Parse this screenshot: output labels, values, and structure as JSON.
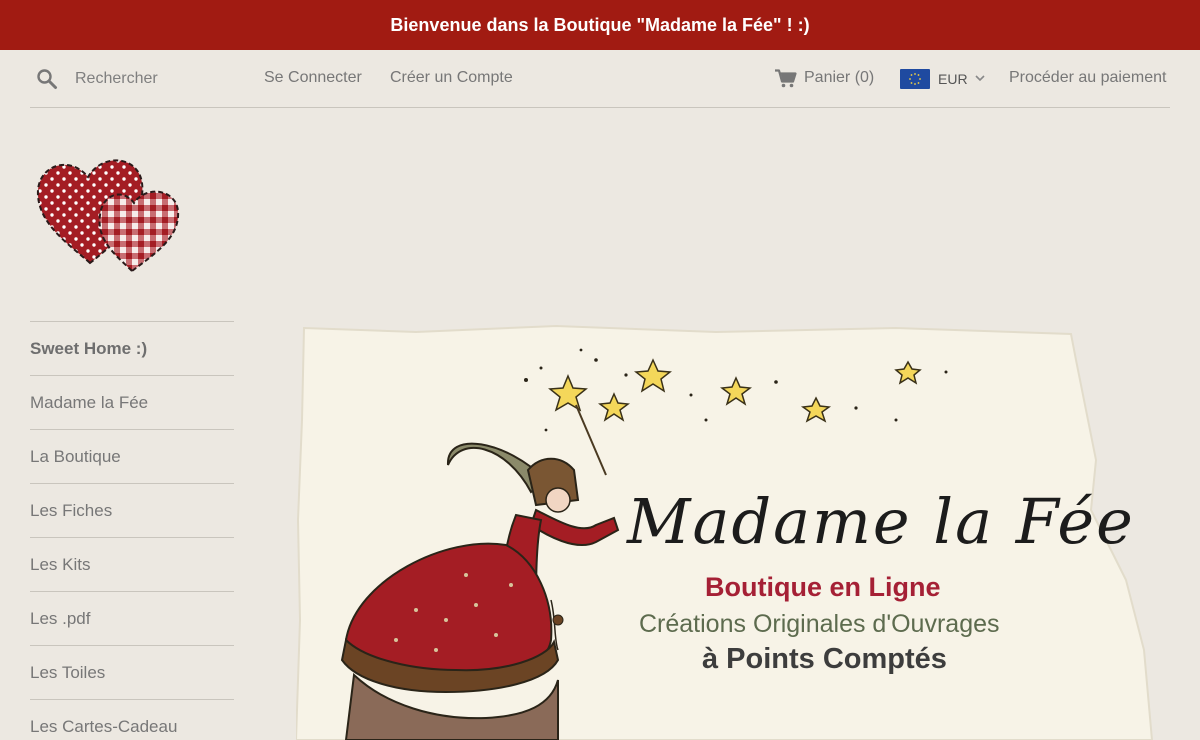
{
  "announcement": "Bienvenue dans la Boutique \"Madame la Fée\" ! :)",
  "header": {
    "search_placeholder": "Rechercher",
    "login": "Se Connecter",
    "register": "Créer un Compte",
    "cart": "Panier (0)",
    "currency": "EUR",
    "checkout": "Procéder au paiement"
  },
  "icons": [
    "search-icon",
    "cart-icon",
    "eu-flag-icon",
    "chevron-down-icon",
    "hearts-logo",
    "fairy-illustration"
  ],
  "sidebar": {
    "items": [
      {
        "label": "Sweet Home :)"
      },
      {
        "label": "Madame la Fée"
      },
      {
        "label": "La Boutique"
      },
      {
        "label": "Les Fiches"
      },
      {
        "label": "Les Kits"
      },
      {
        "label": "Les .pdf"
      },
      {
        "label": "Les Toiles"
      },
      {
        "label": "Les Cartes-Cadeau"
      }
    ]
  },
  "banner": {
    "title": "Madame la Fée",
    "subtitle": "Boutique en Ligne",
    "line2": "Créations Originales d'Ouvrages",
    "line3": "à Points Comptés"
  },
  "colors": {
    "announcement_bg": "#a11b12",
    "page_bg": "#ece8e1",
    "accent_red": "#a52035"
  }
}
